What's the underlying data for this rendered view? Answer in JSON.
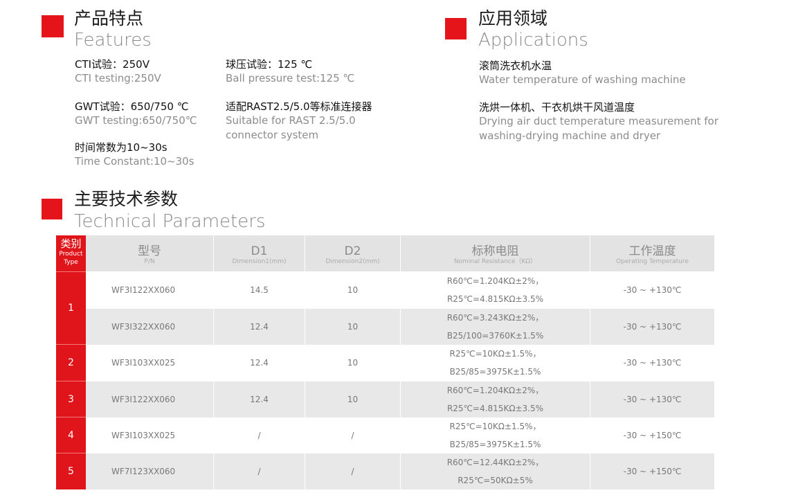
{
  "features": {
    "title_cn": "产品特点",
    "title_en": "Features",
    "items": [
      {
        "title": "CTI试验：250V",
        "sub": "CTI testing:250V"
      },
      {
        "title": "球压试验：125 ℃",
        "sub": "Ball pressure test:125 ℃"
      },
      {
        "title": "GWT试验：650/750 ℃",
        "sub": "GWT testing:650/750℃"
      },
      {
        "title": "适配RAST2.5/5.0等标准连接器",
        "sub": "Suitable for RAST 2.5/5.0",
        "sub2": "connector system"
      },
      {
        "title": "时间常数为10~30s",
        "sub": "Time Constant:10~30s"
      }
    ]
  },
  "applications": {
    "title_cn": "应用领域",
    "title_en": "Applications",
    "items": [
      {
        "title": "滚筒洗衣机水温",
        "sub": "Water temperature of washing machine"
      },
      {
        "title": "洗烘一体机、干衣机烘干风道温度",
        "sub": "Drying air duct temperature measurement for",
        "sub2": "washing-drying machine and dryer"
      }
    ]
  },
  "params": {
    "title_cn": "主要技术参数",
    "title_en": "Technical Parameters"
  },
  "table": {
    "type_header": {
      "cn": "类别",
      "en1": "Product",
      "en2": "Type"
    },
    "headers": [
      {
        "cn": "型号",
        "en": "P/N"
      },
      {
        "cn": "D1",
        "en": "Dimension1(mm)"
      },
      {
        "cn": "D2",
        "en": "Dimension2(mm)"
      },
      {
        "cn": "标称电阻",
        "en": "Nominal Resistance（KΩ）"
      },
      {
        "cn": "工作温度",
        "en": "Operating Temperature"
      }
    ],
    "types": [
      "1",
      "2",
      "3",
      "4",
      "5"
    ],
    "rows": [
      {
        "pn": "WF3I122XX060",
        "d1": "14.5",
        "d2": "10",
        "r1": "R60℃=1.204KΩ±2%，",
        "r2": "R25℃=4.815KΩ±3.5%",
        "temp": "-30 ~ +130℃"
      },
      {
        "pn": "WF3I322XX060",
        "d1": "12.4",
        "d2": "10",
        "r1": "R60℃=3.243KΩ±2%，",
        "r2": "B25/100=3760K±1.5%",
        "temp": "-30 ~ +130℃"
      },
      {
        "pn": "WF3I103XX025",
        "d1": "12.4",
        "d2": "10",
        "r1": "R25℃=10KΩ±1.5%，",
        "r2": "B25/85=3975K±1.5%",
        "temp": "-30 ~ +130℃"
      },
      {
        "pn": "WF3I122XX060",
        "d1": "12.4",
        "d2": "10",
        "r1": "R60℃=1.204KΩ±2%，",
        "r2": "R25℃=4.815KΩ±3.5%",
        "temp": "-30 ~ +130℃"
      },
      {
        "pn": "WF3I103XX025",
        "d1": "/",
        "d2": "/",
        "r1": "R25℃=10KΩ±1.5%，",
        "r2": "B25/85=3975K±1.5%",
        "temp": "-30 ~ +150℃"
      },
      {
        "pn": "WF7I123XX060",
        "d1": "/",
        "d2": "/",
        "r1": "R60℃=12.44KΩ±2%，",
        "r2": "R25℃=50KΩ±5%",
        "temp": "-30 ~ +150℃"
      }
    ]
  },
  "colors": {
    "accent": "#e5141b",
    "header_bg": "#e3e3e3",
    "row_alt": "#e8e8e8"
  }
}
